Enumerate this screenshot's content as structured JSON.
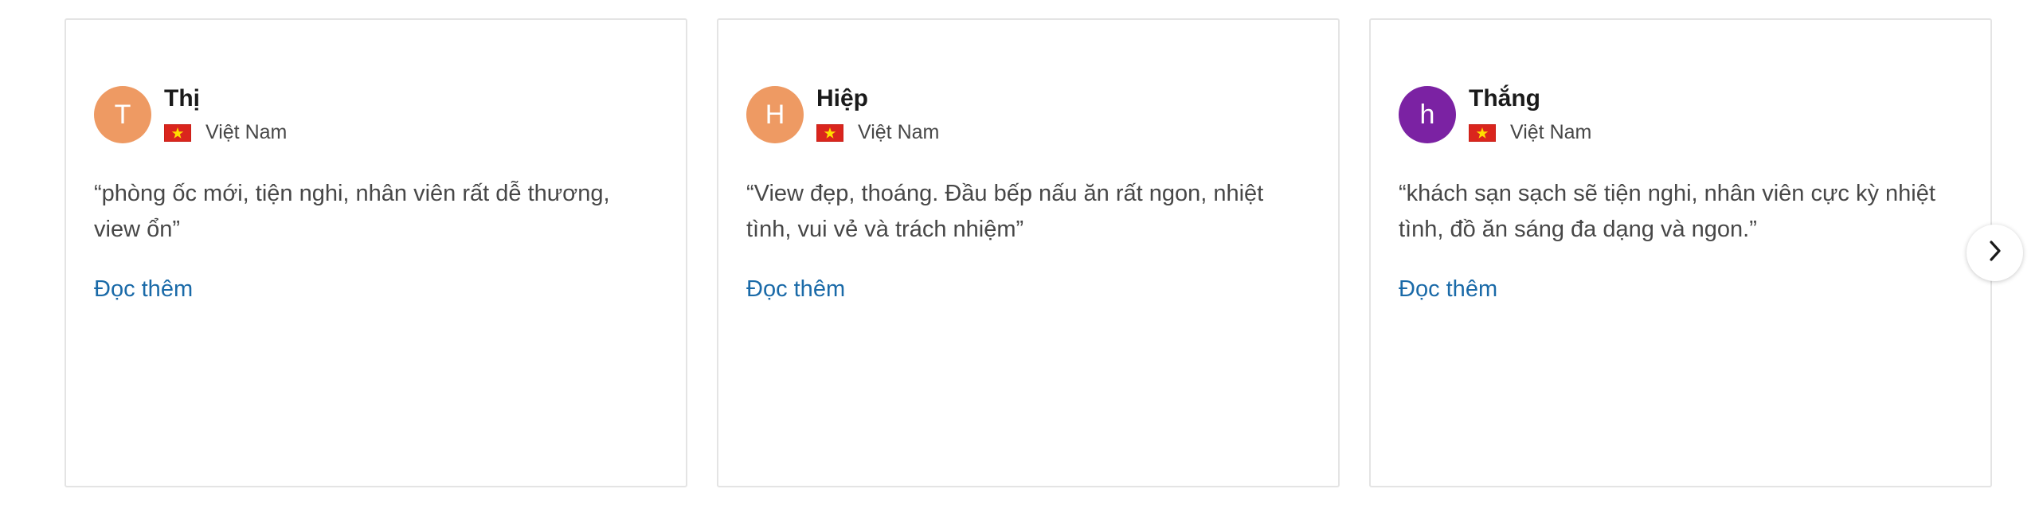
{
  "reviews": [
    {
      "initial": "T",
      "avatar_color": "#ee9a63",
      "name": "Thị",
      "country": "Việt Nam",
      "text": "“phòng ốc mới, tiện nghi, nhân viên rất dễ thương, view ổn”",
      "read_more": "Đọc thêm"
    },
    {
      "initial": "H",
      "avatar_color": "#ee9a63",
      "name": "Hiệp",
      "country": "Việt Nam",
      "text": "“View đẹp, thoáng. Đầu bếp nấu ăn rất ngon, nhiệt tình, vui vẻ và trách nhiệm”",
      "read_more": "Đọc thêm"
    },
    {
      "initial": "h",
      "avatar_color": "#7b22a3",
      "name": "Thắng",
      "country": "Việt Nam",
      "text": "“khách sạn sạch sẽ tiện nghi, nhân viên cực kỳ nhiệt tình, đồ ăn sáng đa dạng và ngon.”",
      "read_more": "Đọc thêm"
    }
  ],
  "navigation": {
    "next_icon": "chevron-right-icon"
  },
  "colors": {
    "link": "#1a6aa8",
    "flag_red": "#da251d",
    "flag_star": "#ffde00"
  }
}
